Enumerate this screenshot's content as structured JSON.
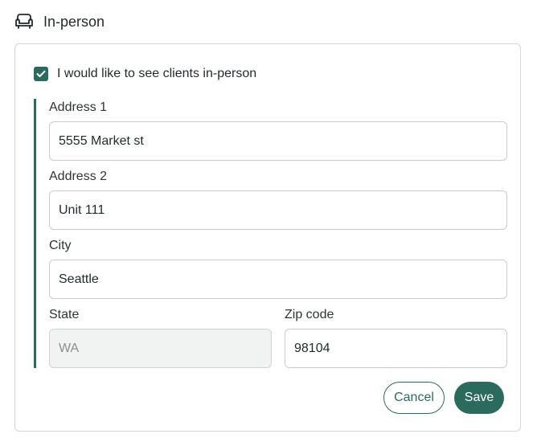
{
  "section": {
    "title": "In-person",
    "icon": "armchair-icon"
  },
  "in_person": {
    "checkbox_label": "I would like to see clients in-person",
    "checked": true
  },
  "form": {
    "address1": {
      "label": "Address 1",
      "value": "5555 Market st"
    },
    "address2": {
      "label": "Address 2",
      "value": "Unit 111"
    },
    "city": {
      "label": "City",
      "value": "Seattle"
    },
    "state": {
      "label": "State",
      "value": "WA",
      "disabled": true
    },
    "zip": {
      "label": "Zip code",
      "value": "98104"
    }
  },
  "actions": {
    "cancel_label": "Cancel",
    "save_label": "Save"
  },
  "colors": {
    "accent": "#2b6b5e",
    "border": "#c7cccc",
    "disabled_bg": "#f1f2f2"
  }
}
